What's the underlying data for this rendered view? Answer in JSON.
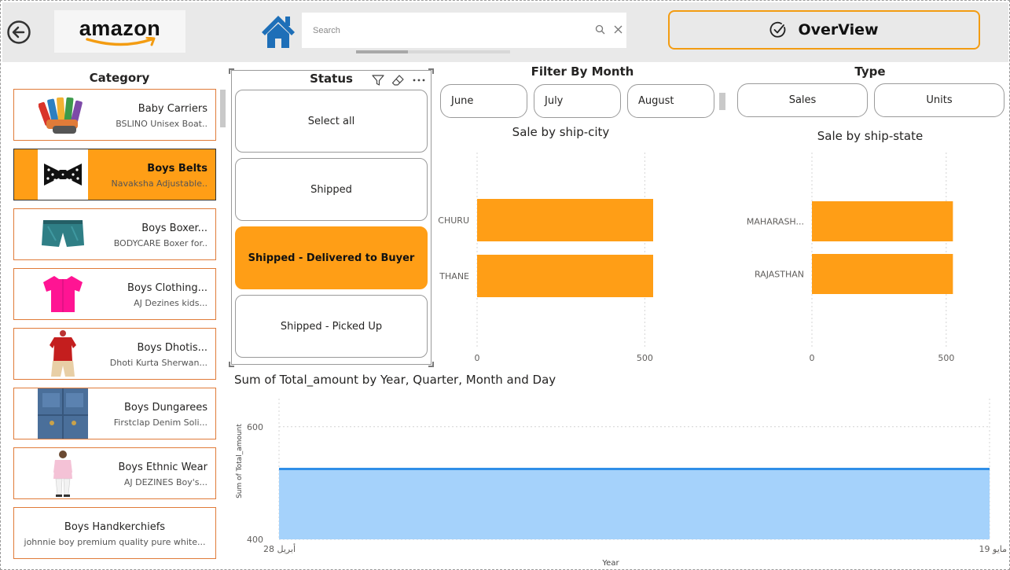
{
  "header": {
    "search": {
      "placeholder": "Search"
    },
    "overview_label": "OverView",
    "logo_text": "amazon",
    "accent_color": "#f39c12"
  },
  "category": {
    "title": "Category",
    "items": [
      {
        "name": "Baby Carriers",
        "desc": "BSLINO Unisex Boat..",
        "icon": "socks-image",
        "selected": false
      },
      {
        "name": "Boys Belts",
        "desc": "Navaksha Adjustable..",
        "icon": "bow-tie-image",
        "selected": true
      },
      {
        "name": "Boys Boxer...",
        "desc": "BODYCARE Boxer for..",
        "icon": "boxer-shorts-image",
        "selected": false
      },
      {
        "name": "Boys Clothing...",
        "desc": "AJ Dezines kids...",
        "icon": "pink-shirt-image",
        "selected": false
      },
      {
        "name": "Boys Dhotis...",
        "desc": "Dhoti Kurta Sherwan...",
        "icon": "kurta-image",
        "selected": false
      },
      {
        "name": "Boys Dungarees",
        "desc": "Firstclap Denim Soli...",
        "icon": "denim-image",
        "selected": false
      },
      {
        "name": "Boys Ethnic Wear",
        "desc": "AJ DEZINES Boy's...",
        "icon": "boy-ethnic-image",
        "selected": false
      },
      {
        "name": "Boys Handkerchiefs",
        "desc": "johnnie boy premium quality pure white...",
        "icon": "",
        "selected": false
      }
    ]
  },
  "status": {
    "title": "Status",
    "options": [
      {
        "label": "Select all",
        "selected": false
      },
      {
        "label": "Shipped",
        "selected": false
      },
      {
        "label": "Shipped - Delivered to Buyer",
        "selected": true
      },
      {
        "label": "Shipped - Picked Up",
        "selected": false
      }
    ]
  },
  "filter_month": {
    "title": "Filter By Month",
    "months": [
      "June",
      "July",
      "August"
    ]
  },
  "type": {
    "title": "Type",
    "options": [
      "Sales",
      "Units"
    ]
  },
  "chart_data": [
    {
      "type": "bar",
      "orientation": "horizontal",
      "title": "Sale by ship-city",
      "categories": [
        "CHURU",
        "THANE"
      ],
      "values": [
        525,
        525
      ],
      "xlim": [
        0,
        600
      ],
      "xticks": [
        0,
        500
      ],
      "grid": true,
      "color": "#ff9e16"
    },
    {
      "type": "bar",
      "orientation": "horizontal",
      "title": "Sale by ship-state",
      "categories": [
        "MAHARASH...",
        "RAJASTHAN"
      ],
      "values": [
        525,
        525
      ],
      "xlim": [
        0,
        600
      ],
      "xticks": [
        0,
        500
      ],
      "grid": true,
      "color": "#ff9e16"
    },
    {
      "type": "area",
      "title": "Sum of Total_amount by Year, Quarter, Month and Day",
      "xlabel": "Year",
      "ylabel": "Sum of Total_amount",
      "x": [
        "أبريل 28",
        "مايو 19"
      ],
      "values": [
        525,
        525
      ],
      "ylim": [
        400,
        650
      ],
      "yticks": [
        400,
        600
      ],
      "grid": true,
      "line_color": "#2f8fe8",
      "fill_color": "#a5d2fb"
    }
  ]
}
